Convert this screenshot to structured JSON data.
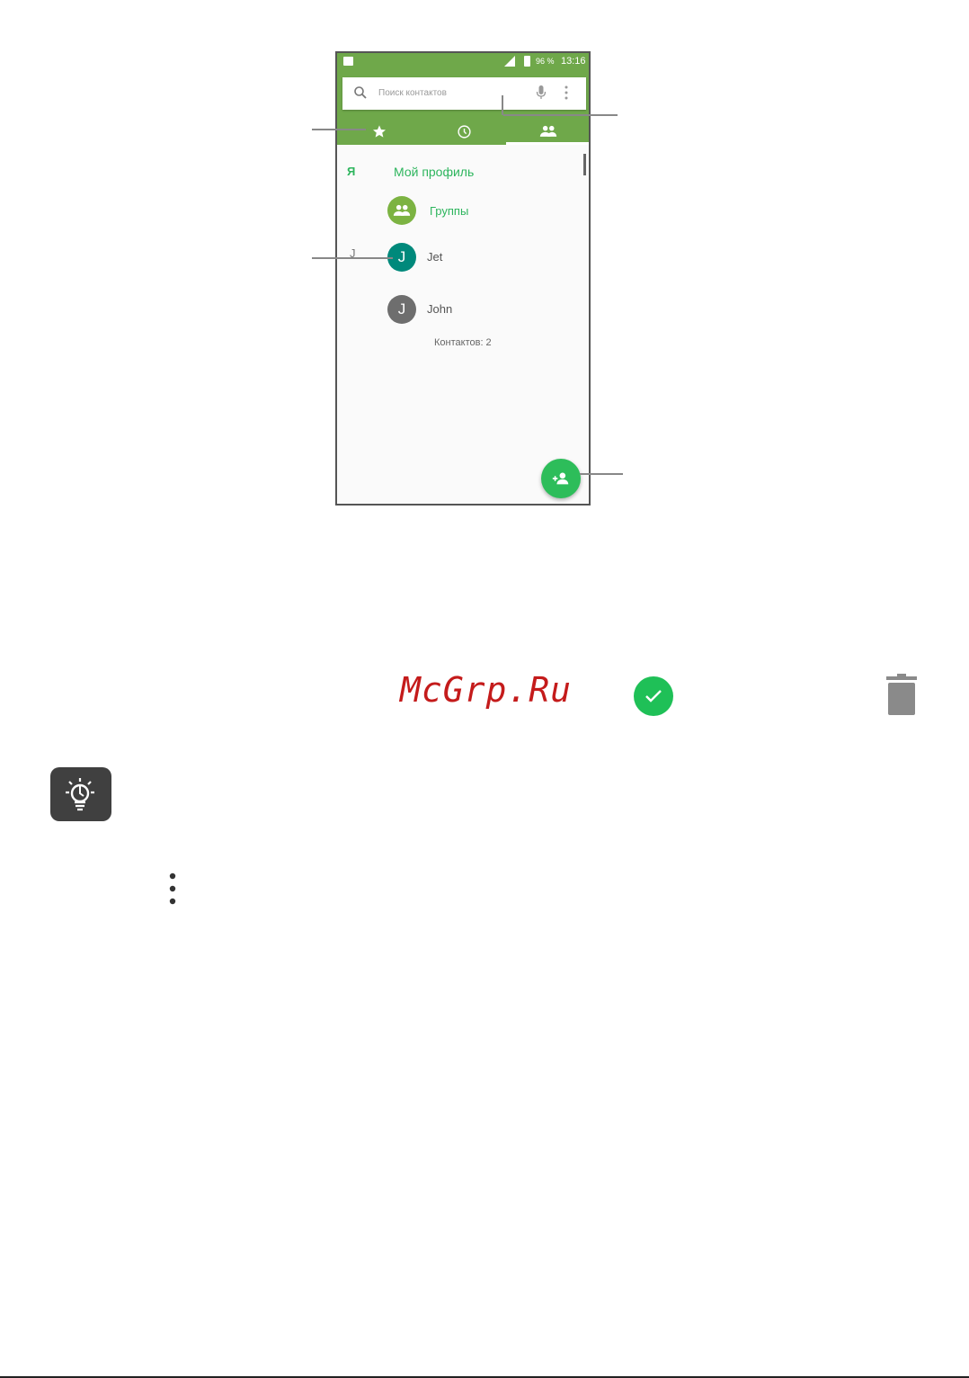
{
  "status_bar": {
    "battery": "96 %",
    "time": "13:16"
  },
  "search": {
    "placeholder": "Поиск контактов"
  },
  "tabs": [
    {
      "icon": "star-icon",
      "active": false
    },
    {
      "icon": "clock-icon",
      "active": false
    },
    {
      "icon": "people-icon",
      "active": true
    }
  ],
  "list": {
    "me_section": "Я",
    "my_profile": "Мой профиль",
    "groups_label": "Группы",
    "section_j": "J",
    "contacts": [
      {
        "initial": "J",
        "name": "Jet",
        "color": "#00897b"
      },
      {
        "initial": "J",
        "name": "John",
        "color": "#6e6e6e"
      }
    ],
    "count_text": "Контактов: 2"
  },
  "fab": {
    "icon": "add-contact-icon",
    "color": "#2dbd5a"
  },
  "accent_color": "#6fa84a",
  "watermark": "McGrp.Ru",
  "below_icons": [
    "check-circle-icon",
    "trash-icon",
    "tip-lightbulb-icon",
    "more-vert-icon"
  ]
}
